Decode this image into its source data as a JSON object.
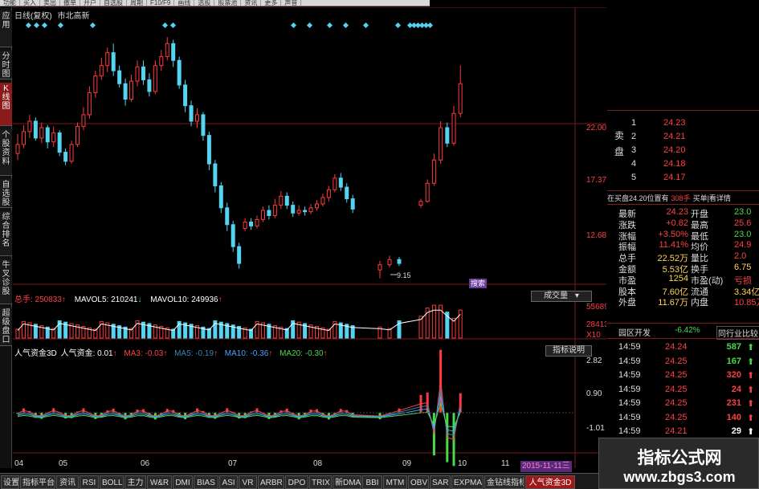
{
  "top_menu": [
    "功能",
    "买入",
    "卖出",
    "撤单",
    "开户",
    "自选股",
    "周期",
    "F10/F9",
    "画线",
    "选股",
    "股票池",
    "资讯",
    "更多",
    "声音"
  ],
  "left_tabs": [
    "应用",
    "分时图",
    "K线图",
    "个股资料",
    "自选股",
    "综合排名",
    "牛叉诊股",
    "超级盘口"
  ],
  "left_tab_active": 2,
  "chart": {
    "title": "日线(复权)",
    "subtitle": "市北高新",
    "price_labels": [
      "22.00",
      "17.37",
      "12.68"
    ],
    "low_marker": "9.15",
    "event_tag": "搜索",
    "volume_header": {
      "label": "总手: 250833",
      "ma5": "MAVOL5: 210241",
      "ma10": "MAVOL10: 249936"
    },
    "volume_labels": [
      "55689",
      "28413",
      "X10"
    ],
    "volume_dropdown": "成交量",
    "indicator_header": {
      "name": "人气资金3D",
      "value": "人气资金: 0.01",
      "ma3": "MA3: -0.03",
      "ma5": "MA5: -0.19",
      "ma10": "MA10: -0.36",
      "ma20": "MA20: -0.30"
    },
    "indicator_labels": [
      "2.82",
      "0.90",
      "-1.01"
    ],
    "indicator_button": "指标说明",
    "x_axis": [
      "04",
      "05",
      "06",
      "07",
      "08",
      "09",
      "10",
      "11"
    ],
    "date_badge": "2015-11-11三",
    "colors": {
      "up": "#ff3b3b",
      "down": "#54d4f0",
      "ma": "#ffffff"
    }
  },
  "right_panel": {
    "sell_side_label": "卖盘",
    "bids": [
      {
        "level": "1",
        "price": "24.23"
      },
      {
        "level": "2",
        "price": "24.21"
      },
      {
        "level": "3",
        "price": "24.20"
      },
      {
        "level": "4",
        "price": "24.18"
      },
      {
        "level": "5",
        "price": "24.17"
      }
    ],
    "buy_label": "买盘",
    "info_line": "在买盘24.20位置有",
    "info_qty": "308手",
    "info_tail": "买单|看详情",
    "stats": [
      {
        "k1": "最新",
        "v1": "24.23",
        "k2": "开盘",
        "v2": "23.0"
      },
      {
        "k1": "涨跌",
        "v1": "+0.82",
        "k2": "最高",
        "v2": "25.6"
      },
      {
        "k1": "涨幅",
        "v1": "+3.50%",
        "k2": "最低",
        "v2": "23.0"
      },
      {
        "k1": "振幅",
        "v1": "11.41%",
        "k2": "均价",
        "v2": "24.9"
      },
      {
        "k1": "总手",
        "v1": "22.52万",
        "k2": "量比",
        "v2": "2.0"
      },
      {
        "k1": "金额",
        "v1": "5.53亿",
        "k2": "换手",
        "v2": "6.75"
      },
      {
        "k1": "市盈",
        "v1": "1254",
        "k2": "市盈(动)",
        "v2": "亏损"
      },
      {
        "k1": "股本",
        "v1": "7.60亿",
        "k2": "流通",
        "v2": "3.34亿"
      },
      {
        "k1": "外盘",
        "v1": "11.67万",
        "k2": "内盘",
        "v2": "10.85万"
      }
    ],
    "sector_name": "园区开发",
    "sector_change": "-6.42%",
    "sector_button": "同行业比较",
    "ticks": [
      {
        "time": "14:59",
        "price": "24.24",
        "vol": "587",
        "dir": "up"
      },
      {
        "time": "14:59",
        "price": "24.25",
        "vol": "167",
        "dir": "up"
      },
      {
        "time": "14:59",
        "price": "24.25",
        "vol": "320",
        "dir": "up"
      },
      {
        "time": "14:59",
        "price": "24.25",
        "vol": "24",
        "dir": "up"
      },
      {
        "time": "14:59",
        "price": "24.25",
        "vol": "231",
        "dir": "up"
      },
      {
        "time": "14:59",
        "price": "24.25",
        "vol": "140",
        "dir": "up"
      },
      {
        "time": "14:59",
        "price": "24.21",
        "vol": "29",
        "dir": "up"
      },
      {
        "time": "14:59",
        "price": "24.21",
        "vol": "",
        "dir": ""
      }
    ]
  },
  "bottom_tabs": [
    "设置",
    "指标平台",
    "资讯",
    "RSI",
    "BOLL",
    "主力",
    "W&R",
    "DMI",
    "BIAS",
    "ASI",
    "VR",
    "ARBR",
    "DPO",
    "TRIX",
    "新DMA",
    "BBI",
    "MTM",
    "OBV",
    "SAR",
    "EXPMA",
    "金钻线指标",
    "人气资金3D"
  ],
  "bottom_tab_active": 21,
  "watermark": {
    "line1": "指标公式网",
    "line2": "www.zbgs3.com"
  }
}
